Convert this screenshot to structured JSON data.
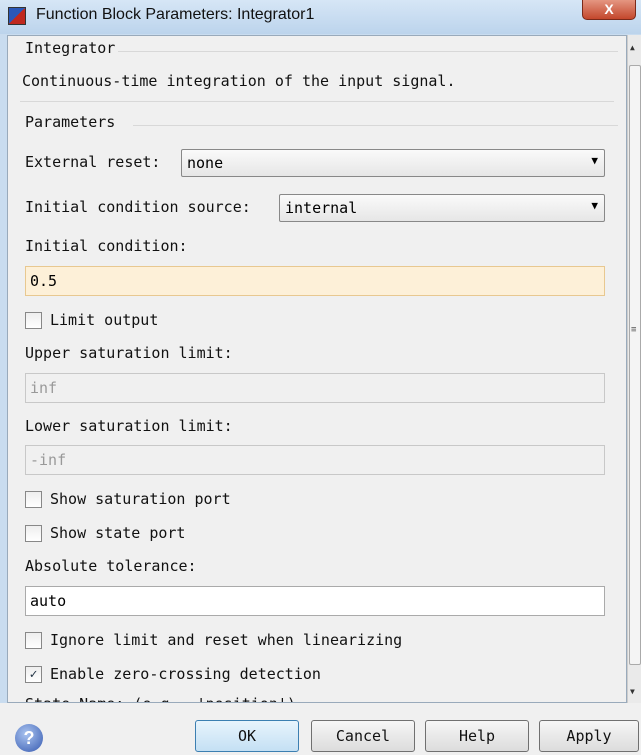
{
  "window": {
    "title": "Function Block Parameters: Integrator1",
    "close_label": "X"
  },
  "block": {
    "name": "Integrator",
    "description": "Continuous-time integration of the input signal."
  },
  "parameters": {
    "heading": "Parameters",
    "external_reset": {
      "label": "External reset:",
      "value": "none"
    },
    "ic_source": {
      "label": "Initial condition source:",
      "value": "internal"
    },
    "initial_condition": {
      "label": "Initial condition:",
      "value": "0.5"
    },
    "limit_output": {
      "label": "Limit output",
      "checked": false
    },
    "upper": {
      "label": "Upper saturation limit:",
      "value": "inf"
    },
    "lower": {
      "label": "Lower saturation limit:",
      "value": "-inf"
    },
    "show_sat_port": {
      "label": "Show saturation port",
      "checked": false
    },
    "show_state_port": {
      "label": "Show state port",
      "checked": false
    },
    "abs_tol": {
      "label": "Absolute tolerance:",
      "value": "auto"
    },
    "ignore_limit": {
      "label": "Ignore limit and reset when linearizing",
      "checked": false
    },
    "zero_crossing": {
      "label": "Enable zero-crossing detection",
      "checked": true,
      "mark": "✓"
    },
    "state_name": {
      "label": "State Name: (e.g., 'position')"
    }
  },
  "buttons": {
    "ok": "OK",
    "cancel": "Cancel",
    "help": "Help",
    "apply": "Apply",
    "help_icon": "?"
  }
}
